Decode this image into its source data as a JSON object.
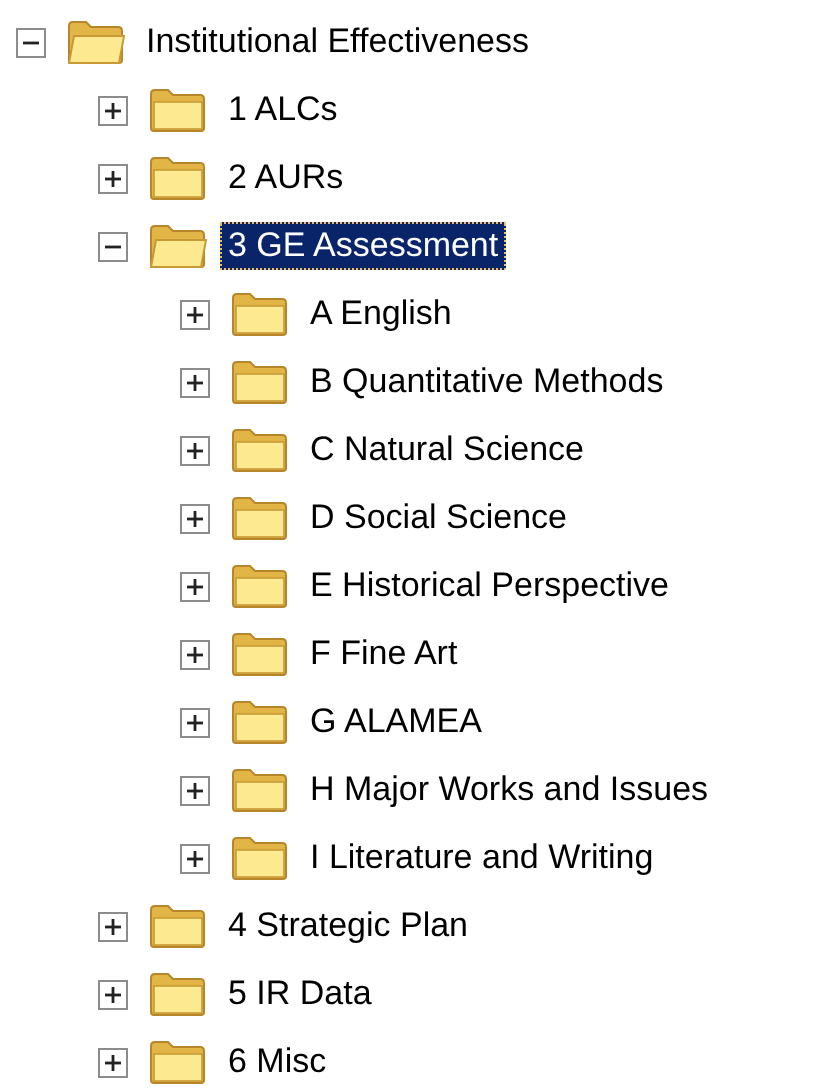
{
  "tree": [
    {
      "label": "Institutional Effectiveness",
      "expanded": true,
      "selected": false,
      "children": [
        {
          "label": "1 ALCs",
          "expanded": false,
          "selected": false
        },
        {
          "label": "2 AURs",
          "expanded": false,
          "selected": false
        },
        {
          "label": "3 GE Assessment",
          "expanded": true,
          "selected": true,
          "children": [
            {
              "label": "A English",
              "expanded": false,
              "selected": false
            },
            {
              "label": "B Quantitative Methods",
              "expanded": false,
              "selected": false
            },
            {
              "label": "C Natural Science",
              "expanded": false,
              "selected": false
            },
            {
              "label": "D Social Science",
              "expanded": false,
              "selected": false
            },
            {
              "label": "E Historical Perspective",
              "expanded": false,
              "selected": false
            },
            {
              "label": "F Fine Art",
              "expanded": false,
              "selected": false
            },
            {
              "label": "G ALAMEA",
              "expanded": false,
              "selected": false
            },
            {
              "label": "H Major Works and Issues",
              "expanded": false,
              "selected": false
            },
            {
              "label": "I Literature and Writing",
              "expanded": false,
              "selected": false
            }
          ]
        },
        {
          "label": "4 Strategic Plan",
          "expanded": false,
          "selected": false
        },
        {
          "label": "5 IR Data",
          "expanded": false,
          "selected": false
        },
        {
          "label": "6 Misc",
          "expanded": false,
          "selected": false
        }
      ]
    }
  ]
}
